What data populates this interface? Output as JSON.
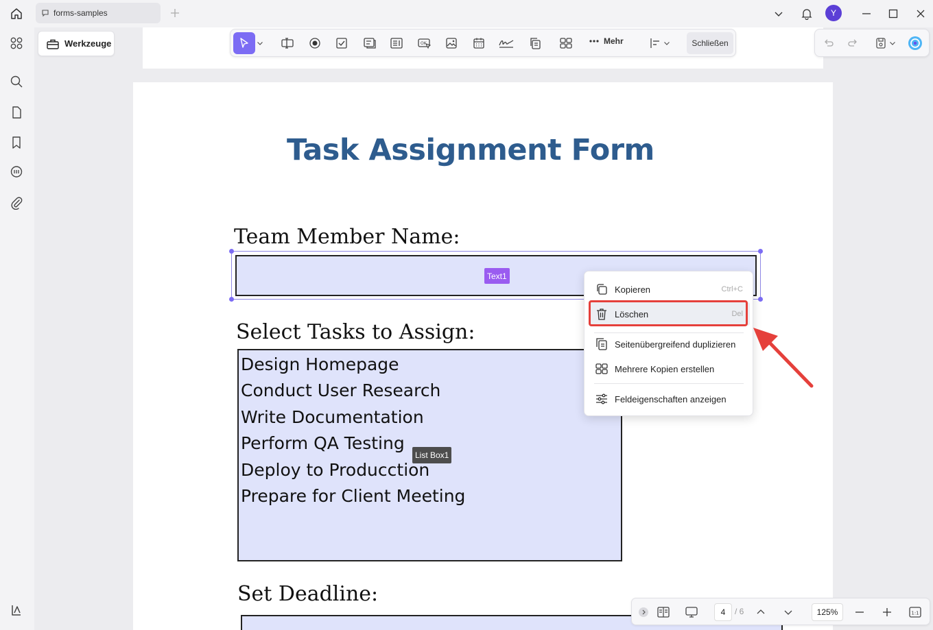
{
  "titlebar": {
    "tab_title": "forms-samples",
    "avatar_initial": "Y"
  },
  "toolbar": {
    "tools_label": "Werkzeuge",
    "more_label": "Mehr",
    "close_label": "Schließen"
  },
  "document": {
    "title": "Task Assignment Form",
    "label_name": "Team Member Name:",
    "label_tasks": "Select Tasks to Assign:",
    "label_deadline": "Set Deadline:",
    "text_field_tag": "Text1",
    "list_box_tag": "List Box1",
    "tasks": [
      "Design Homepage",
      "Conduct User Research",
      "Write Documentation",
      "Perform QA Testing",
      "Deploy to Producction",
      "Prepare for Client Meeting"
    ]
  },
  "context_menu": {
    "copy_label": "Kopieren",
    "copy_shortcut": "Ctrl+C",
    "delete_label": "Löschen",
    "delete_shortcut": "Del",
    "duplicate_label": "Seitenübergreifend duplizieren",
    "multiple_copies_label": "Mehrere Kopien erstellen",
    "properties_label": "Feldeigenschaften anzeigen"
  },
  "bottombar": {
    "current_page": "4",
    "total_pages": "/ 6",
    "zoom": "125%",
    "fit_label": "1:1"
  },
  "colors": {
    "accent": "#7c6cf4",
    "title_blue": "#2e5c8e",
    "field_fill": "#dfe3fb",
    "highlight_red": "#e5403b"
  }
}
